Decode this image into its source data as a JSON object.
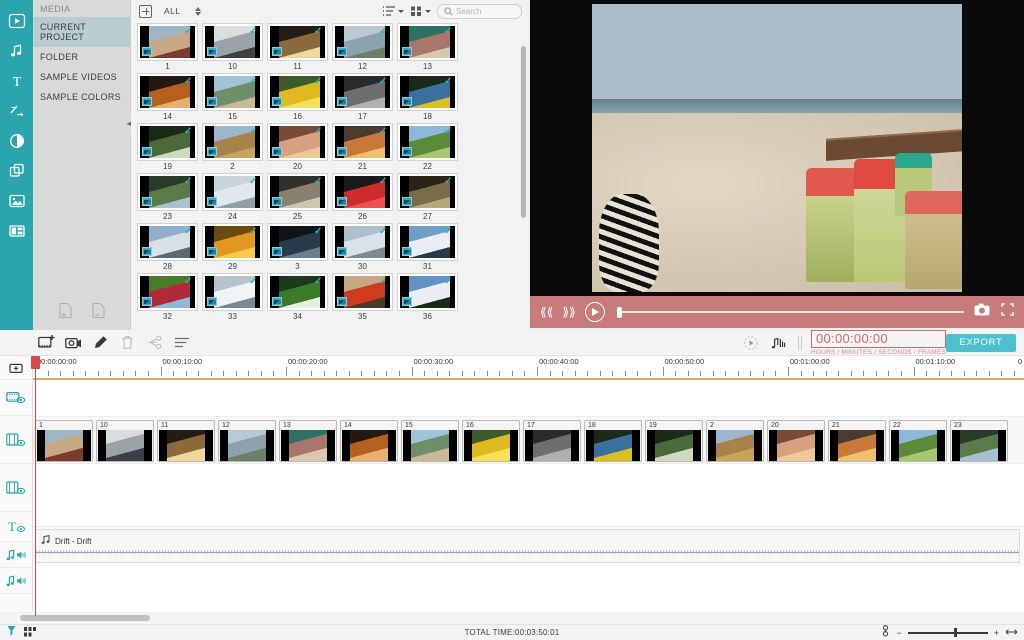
{
  "app": {
    "accent_teal": "#2aa5ae",
    "accent_red": "#d46a6a",
    "export_color": "#4cc0cc"
  },
  "rail": {
    "items": [
      {
        "name": "media-tab",
        "icon": "media-play-box-icon",
        "active": true
      },
      {
        "name": "audio-tab",
        "icon": "music-note-icon",
        "active": false
      },
      {
        "name": "titles-tab",
        "icon": "text-t-icon",
        "active": false
      },
      {
        "name": "transitions-tab",
        "icon": "transition-arrows-icon",
        "active": false
      },
      {
        "name": "filters-tab",
        "icon": "filter-circle-icon",
        "active": false
      },
      {
        "name": "overlays-tab",
        "icon": "overlay-squares-icon",
        "active": false
      },
      {
        "name": "elements-tab",
        "icon": "picture-icon",
        "active": false
      },
      {
        "name": "split-screen-tab",
        "icon": "split-screen-icon",
        "active": false
      }
    ]
  },
  "library": {
    "title": "MEDIA",
    "items": [
      {
        "label": "CURRENT PROJECT",
        "selected": true
      },
      {
        "label": "FOLDER",
        "selected": false
      },
      {
        "label": "SAMPLE VIDEOS",
        "selected": false
      },
      {
        "label": "SAMPLE COLORS",
        "selected": false
      }
    ],
    "add_file_icon": "add-file-icon",
    "remove_file_icon": "remove-file-icon",
    "collapse_icon": "collapse-left-icon"
  },
  "media_toolbar": {
    "add_icon": "add-media-icon",
    "filter_label": "ALL",
    "stepper_icon": "sort-stepper-icon",
    "list_view_icon": "list-view-icon",
    "grid_view_icon": "grid-view-icon",
    "search_icon": "search-icon",
    "search_placeholder": "Search",
    "search_value": ""
  },
  "media_grid": {
    "checkmark": "✓",
    "items": [
      {
        "label": "1",
        "c1": "#9fb6c4",
        "c2": "#c8a882",
        "c3": "#7c3a2e"
      },
      {
        "label": "10",
        "c1": "#d8dde0",
        "c2": "#9aa3a8",
        "c3": "#3b4044"
      },
      {
        "label": "11",
        "c1": "#241c16",
        "c2": "#8a6a3a",
        "c3": "#f0d79a"
      },
      {
        "label": "12",
        "c1": "#b9c9d4",
        "c2": "#8ea2ad",
        "c3": "#6d7f6a"
      },
      {
        "label": "13",
        "c1": "#2e6f66",
        "c2": "#a8776a",
        "c3": "#d8c8b0"
      },
      {
        "label": "14",
        "c1": "#241a12",
        "c2": "#b5601f",
        "c3": "#e8b070"
      },
      {
        "label": "15",
        "c1": "#9fc4d8",
        "c2": "#6f8f6a",
        "c3": "#cbb894"
      },
      {
        "label": "16",
        "c1": "#3c5a2a",
        "c2": "#e0b820",
        "c3": "#f5e05a"
      },
      {
        "label": "17",
        "c1": "#2a2a2a",
        "c2": "#6e6e6e",
        "c3": "#b0b0b0"
      },
      {
        "label": "18",
        "c1": "#1a2a18",
        "c2": "#3a6fa0",
        "c3": "#d8c020"
      },
      {
        "label": "19",
        "c1": "#1b2a18",
        "c2": "#4a6a3a",
        "c3": "#cfd8c0"
      },
      {
        "label": "2",
        "c1": "#9cb7cc",
        "c2": "#a8824a",
        "c3": "#c8a45a"
      },
      {
        "label": "20",
        "c1": "#7a4a38",
        "c2": "#d8a080",
        "c3": "#f0c898"
      },
      {
        "label": "21",
        "c1": "#4a3a30",
        "c2": "#c87838",
        "c3": "#f0c070"
      },
      {
        "label": "22",
        "c1": "#8fb8d8",
        "c2": "#5a8a3a",
        "c3": "#a8c870"
      },
      {
        "label": "23",
        "c1": "#2a3a28",
        "c2": "#5a7a48",
        "c3": "#a8c0d0"
      },
      {
        "label": "24",
        "c1": "#c8d4dc",
        "c2": "#e0e8ee",
        "c3": "#90a0a8"
      },
      {
        "label": "25",
        "c1": "#32302c",
        "c2": "#8a8070",
        "c3": "#cfc4ae"
      },
      {
        "label": "26",
        "c1": "#1a1a1a",
        "c2": "#d02a2a",
        "c3": "#f05050"
      },
      {
        "label": "27",
        "c1": "#2a2418",
        "c2": "#7a6a48",
        "c3": "#b8a878"
      },
      {
        "label": "28",
        "c1": "#8fb0cc",
        "c2": "#d8e0e8",
        "c3": "#5a6a78"
      },
      {
        "label": "29",
        "c1": "#6a4a10",
        "c2": "#e09820",
        "c3": "#f8c850"
      },
      {
        "label": "3",
        "c1": "#0e1418",
        "c2": "#2a3a48",
        "c3": "#6a8090"
      },
      {
        "label": "30",
        "c1": "#aebfcb",
        "c2": "#d8e2e8",
        "c3": "#7b8a94"
      },
      {
        "label": "31",
        "c1": "#6f9fc8",
        "c2": "#e8eef2",
        "c3": "#2a3a48"
      },
      {
        "label": "32",
        "c1": "#4a7a2a",
        "c2": "#b02a3a",
        "c3": "#8fb8d8"
      },
      {
        "label": "33",
        "c1": "#b8c4cc",
        "c2": "#f0f4f6",
        "c3": "#7a8a94"
      },
      {
        "label": "34",
        "c1": "#1a3a18",
        "c2": "#3a7a28",
        "c3": "#e8f0e0"
      },
      {
        "label": "35",
        "c1": "#c8a880",
        "c2": "#d03a20",
        "c3": "#4a3a28"
      },
      {
        "label": "36",
        "c1": "#5f93c4",
        "c2": "#e8f0f6",
        "c3": "#1a2a18"
      }
    ]
  },
  "preview": {
    "scene_description": "beach-with-pickle-jars",
    "controls": {
      "prev_icon": "skip-previous-icon",
      "next_icon": "skip-next-icon",
      "play_icon": "play-icon",
      "snapshot_icon": "camera-snapshot-icon",
      "fullscreen_icon": "fullscreen-icon"
    }
  },
  "timeline_toolbar": {
    "buttons": [
      {
        "name": "add-media-to-timeline-button",
        "icon": "add-clip-icon",
        "enabled": true
      },
      {
        "name": "record-voiceover-button",
        "icon": "camera-record-icon",
        "enabled": true
      },
      {
        "name": "crop-tool-button",
        "icon": "pen-marker-icon",
        "enabled": true
      },
      {
        "name": "delete-button",
        "icon": "trash-icon",
        "enabled": false
      },
      {
        "name": "split-button",
        "icon": "split-merge-icon",
        "enabled": false
      },
      {
        "name": "settings-button",
        "icon": "sliders-icon",
        "enabled": true
      }
    ],
    "render_icon": "render-preview-icon",
    "audio-mixer_icon": "audio-mixer-icon",
    "timecode": "00:00:00:00",
    "timecode_sub": "HOURS / MINUTES / SECONDS / FRAMES",
    "export_label": "EXPORT"
  },
  "timeline": {
    "track_heads": [
      {
        "name": "track-head-add",
        "icon": "add-track-icon"
      },
      {
        "name": "track-head-overlay",
        "icon": "pip-overlay-eye-icon"
      },
      {
        "name": "track-head-video-1",
        "icon": "video-track-eye-icon"
      },
      {
        "name": "track-head-video-2",
        "icon": "video-track-eye-icon"
      },
      {
        "name": "track-head-text",
        "icon": "text-track-eye-icon"
      },
      {
        "name": "track-head-audio-1",
        "icon": "audio-track-speaker-icon"
      },
      {
        "name": "track-head-audio-2",
        "icon": "audio-track-speaker-icon"
      },
      {
        "name": "track-head-marker",
        "icon": "marker-icon"
      }
    ],
    "ruler_labels": [
      "00:00:00:00",
      "00:00:10:00",
      "00:00:20:00",
      "00:00:30:00",
      "00:00:40:00",
      "00:00:50:00",
      "00:01:00:00",
      "00:01:10:00"
    ],
    "clips": [
      {
        "label": "1",
        "c1": "#9fb6c4",
        "c2": "#c8a882",
        "c3": "#7c3a2e"
      },
      {
        "label": "10",
        "c1": "#d8dde0",
        "c2": "#9aa3a8",
        "c3": "#3b4044"
      },
      {
        "label": "11",
        "c1": "#241c16",
        "c2": "#8a6a3a",
        "c3": "#f0d79a"
      },
      {
        "label": "12",
        "c1": "#b9c9d4",
        "c2": "#8ea2ad",
        "c3": "#6d7f6a"
      },
      {
        "label": "13",
        "c1": "#2e6f66",
        "c2": "#a8776a",
        "c3": "#d8c8b0"
      },
      {
        "label": "14",
        "c1": "#241a12",
        "c2": "#b5601f",
        "c3": "#e8b070"
      },
      {
        "label": "15",
        "c1": "#9fc4d8",
        "c2": "#6f8f6a",
        "c3": "#cbb894"
      },
      {
        "label": "16",
        "c1": "#3c5a2a",
        "c2": "#e0b820",
        "c3": "#f5e05a"
      },
      {
        "label": "17",
        "c1": "#2a2a2a",
        "c2": "#6e6e6e",
        "c3": "#b0b0b0"
      },
      {
        "label": "18",
        "c1": "#1a2a18",
        "c2": "#3a6fa0",
        "c3": "#d8c020"
      },
      {
        "label": "19",
        "c1": "#1b2a18",
        "c2": "#4a6a3a",
        "c3": "#cfd8c0"
      },
      {
        "label": "2",
        "c1": "#9cb7cc",
        "c2": "#a8824a",
        "c3": "#c8a45a"
      },
      {
        "label": "20",
        "c1": "#7a4a38",
        "c2": "#d8a080",
        "c3": "#f0c898"
      },
      {
        "label": "21",
        "c1": "#4a3a30",
        "c2": "#c87838",
        "c3": "#f0c070"
      },
      {
        "label": "22",
        "c1": "#8fb8d8",
        "c2": "#5a8a3a",
        "c3": "#a8c870"
      },
      {
        "label": "23",
        "c1": "#2a3a28",
        "c2": "#5a7a48",
        "c3": "#a8c0d0"
      }
    ],
    "audio_clip": {
      "label": "Drift - Drift",
      "icon": "music-note-icon"
    }
  },
  "status_bar": {
    "snapshot_icon": "export-snapshot-icon",
    "grid_icon": "storyboard-grid-icon",
    "total_time": "TOTAL TIME:00:03:50:01",
    "link_icon": "link-zoom-icon",
    "zoom_out_label": "−",
    "zoom_in_label": "+",
    "fit_icon": "fit-timeline-icon"
  }
}
